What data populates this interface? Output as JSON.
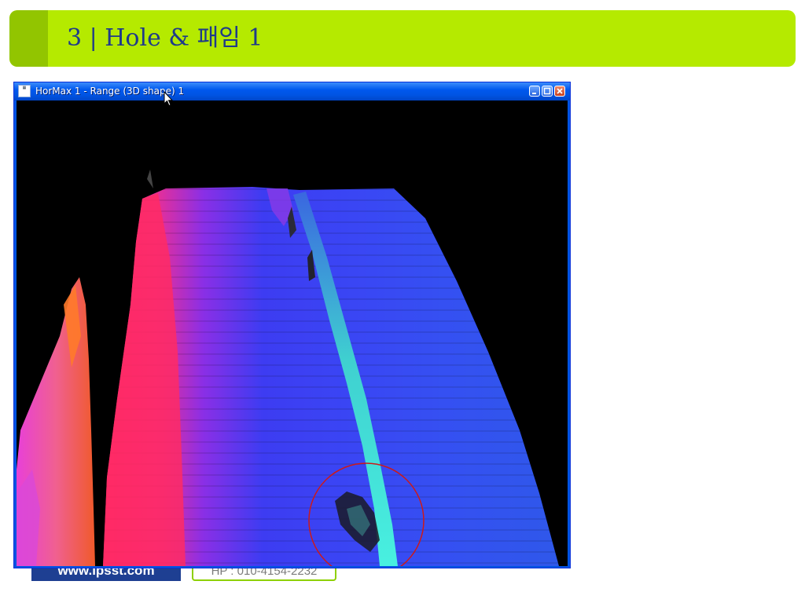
{
  "slide": {
    "title": "3 | Hole & 패임 1"
  },
  "footer": {
    "website": "www.ipsst.com",
    "phone": "HP : 010-4154-2232"
  },
  "window": {
    "title": "HorMax 1 - Range (3D shape) 1",
    "icon_name": "hormax-app-icon",
    "controls": [
      "minimize",
      "maximize",
      "close"
    ]
  },
  "visual": {
    "content": "3d-range-surface-render",
    "highlight": "red-circle-annotation",
    "colors": {
      "title_bar": "#b5ea00",
      "title_accent": "#92c500",
      "title_text": "#1f3a8a",
      "window_frame": "#0054e3",
      "render_background": "#000000",
      "annotation": "#cc1a1a"
    }
  }
}
